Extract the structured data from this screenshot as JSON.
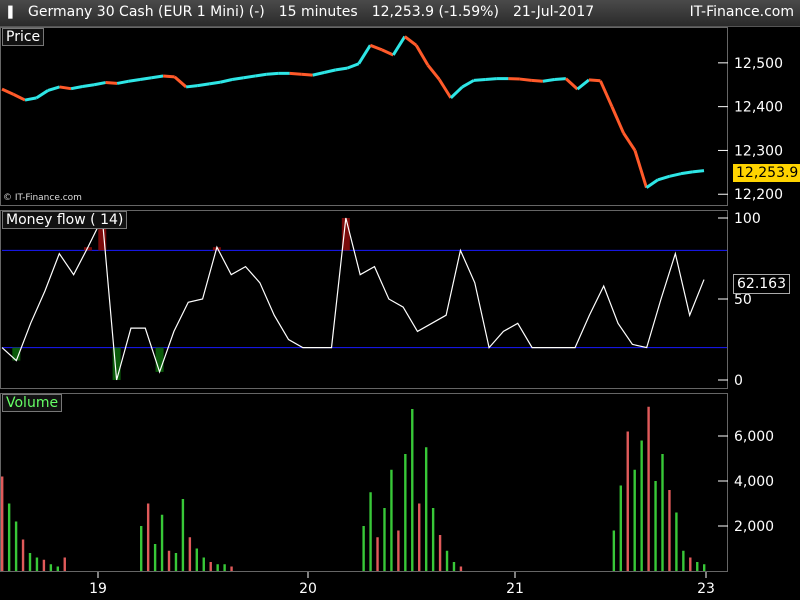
{
  "header": {
    "instrument": "Germany 30 Cash (EUR 1 Mini) (-)",
    "timeframe": "15 minutes",
    "last": "12,253.9 (-1.59%)",
    "date": "21-Jul-2017",
    "brand": "IT-Finance.com"
  },
  "colors": {
    "up": "#2ee6e6",
    "down": "#ff5a2a",
    "vol_up": "#38c838",
    "vol_down": "#e05a5a",
    "level_line": "#1a1aff",
    "price_tag_bg": "#ffd400"
  },
  "chart_data": [
    {
      "type": "line",
      "panel": "price",
      "title": "Price",
      "series": [
        {
          "values": [
            12440,
            12428,
            12415,
            12420,
            12437,
            12445,
            12441,
            12446,
            12450,
            12455,
            12453,
            12458,
            12462,
            12466,
            12470,
            12468,
            12445,
            12448,
            12452,
            12456,
            12462,
            12466,
            12470,
            12474,
            12476,
            12476,
            12474,
            12472,
            12478,
            12484,
            12488,
            12498,
            12540,
            12530,
            12518,
            12560,
            12540,
            12495,
            12462,
            12420,
            12445,
            12460,
            12462,
            12464,
            12464,
            12463,
            12460,
            12458,
            12462,
            12464,
            12440,
            12461,
            12459,
            12400,
            12340,
            12300,
            12215,
            12233,
            12241,
            12247,
            12251,
            12254
          ]
        }
      ],
      "y_ticks": [
        "12,500",
        "12,400",
        "12,300",
        "12,200"
      ],
      "ylim": [
        12180,
        12575
      ],
      "last_value_label": "12,253.9",
      "watermark": "© IT-Finance.com"
    },
    {
      "type": "line",
      "panel": "money_flow",
      "title": "Money flow ( 14)",
      "levels": [
        80,
        20
      ],
      "y_ticks": [
        "100",
        "50",
        "0"
      ],
      "ylim": [
        0,
        100
      ],
      "last_value_label": "62.163",
      "series": [
        {
          "values": [
            20,
            12,
            35,
            55,
            78,
            65,
            82,
            100,
            0,
            32,
            32,
            5,
            30,
            48,
            50,
            82,
            65,
            70,
            60,
            40,
            25,
            20,
            20,
            20,
            100,
            65,
            70,
            50,
            45,
            30,
            35,
            40,
            80,
            60,
            20,
            30,
            35,
            20,
            20,
            20,
            20,
            40,
            58,
            35,
            22,
            20,
            50,
            78,
            40,
            62
          ]
        }
      ]
    },
    {
      "type": "bar",
      "panel": "volume",
      "title": "Volume",
      "y_ticks": [
        "6,000",
        "4,000",
        "2,000"
      ],
      "ylim": [
        0,
        7600
      ],
      "x_ticks": [
        "19",
        "20",
        "21",
        "23"
      ],
      "values": [
        4200,
        3000,
        2200,
        1400,
        800,
        600,
        500,
        300,
        200,
        600,
        0,
        0,
        0,
        0,
        0,
        0,
        0,
        0,
        0,
        0,
        2000,
        3000,
        1200,
        2500,
        900,
        800,
        3200,
        1500,
        1000,
        600,
        400,
        300,
        300,
        200,
        0,
        0,
        0,
        0,
        0,
        0,
        0,
        0,
        0,
        0,
        0,
        0,
        0,
        0,
        0,
        0,
        0,
        0,
        2000,
        3500,
        1500,
        2800,
        4500,
        1800,
        5200,
        7200,
        3000,
        5500,
        2800,
        1600,
        900,
        400,
        200,
        0,
        0,
        0,
        0,
        0,
        0,
        0,
        0,
        0,
        0,
        0,
        0,
        0,
        0,
        0,
        0,
        0,
        0,
        0,
        0,
        0,
        1800,
        3800,
        6200,
        4500,
        5800,
        7300,
        4000,
        5200,
        3600,
        2600,
        900,
        600,
        400,
        300
      ]
    }
  ]
}
